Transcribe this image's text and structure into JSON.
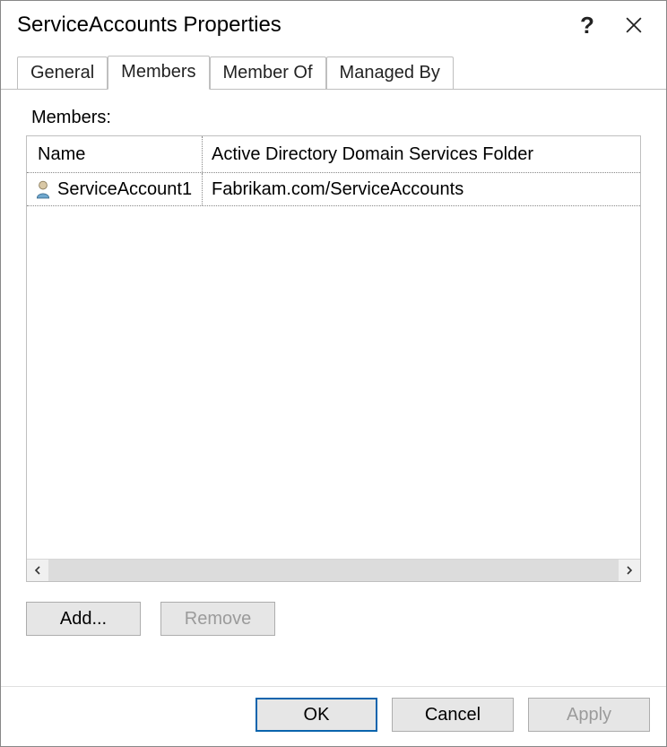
{
  "titlebar": {
    "title": "ServiceAccounts Properties",
    "help_glyph": "?"
  },
  "tabs": [
    {
      "label": "General",
      "active": false
    },
    {
      "label": "Members",
      "active": true
    },
    {
      "label": "Member Of",
      "active": false
    },
    {
      "label": "Managed By",
      "active": false
    }
  ],
  "members": {
    "label": "Members:",
    "columns": {
      "name": "Name",
      "folder": "Active Directory Domain Services Folder"
    },
    "rows": [
      {
        "name": "ServiceAccount1",
        "folder": "Fabrikam.com/ServiceAccounts"
      }
    ]
  },
  "buttons": {
    "add": "Add...",
    "remove": "Remove",
    "ok": "OK",
    "cancel": "Cancel",
    "apply": "Apply"
  }
}
